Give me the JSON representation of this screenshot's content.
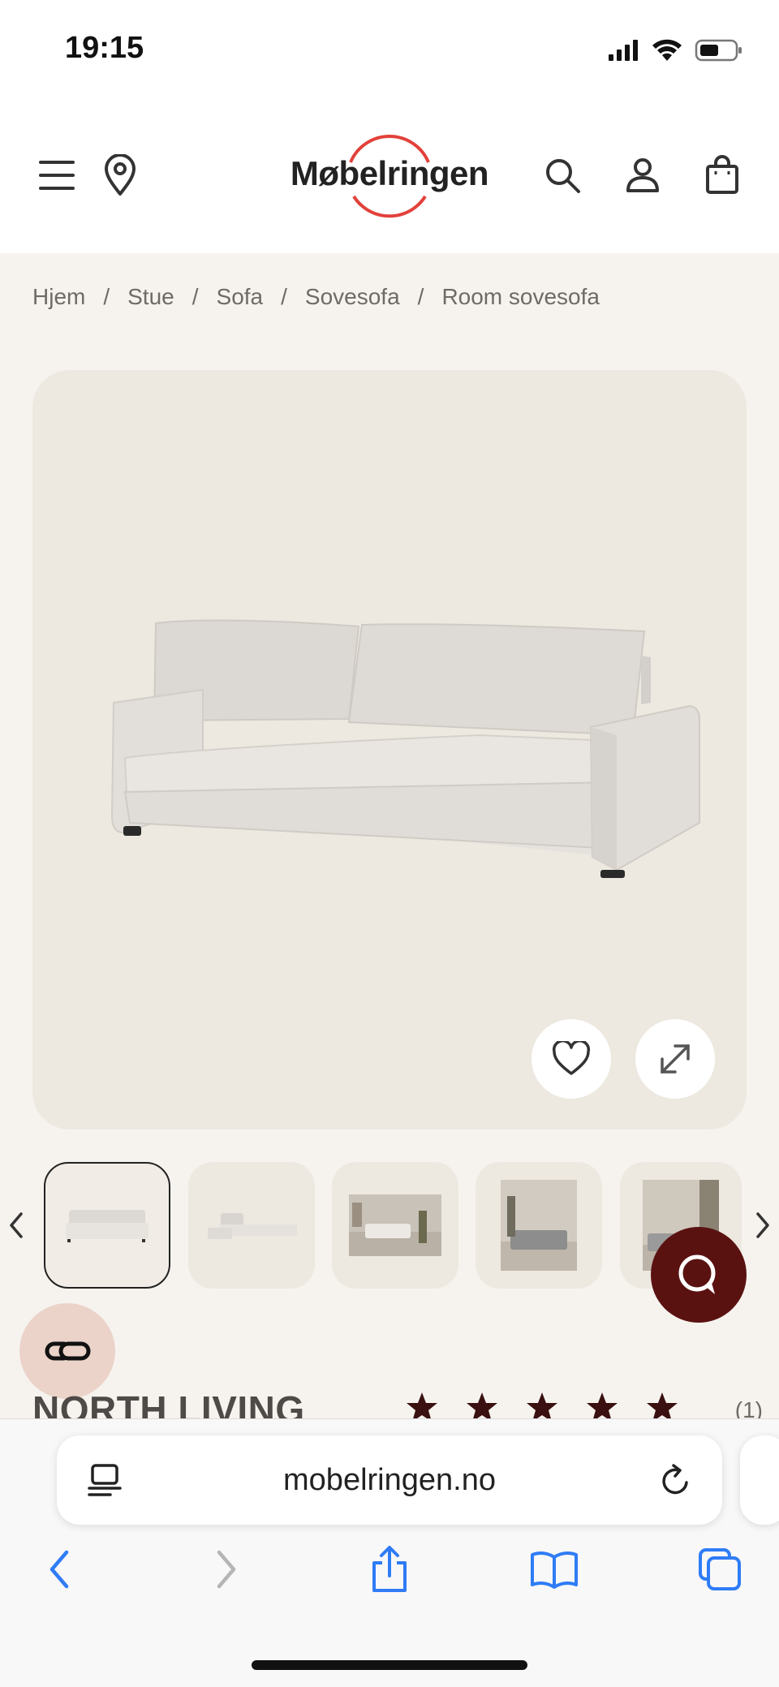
{
  "status_bar": {
    "time": "19:15"
  },
  "header": {
    "logo_text": "Møbelringen",
    "brand_color": "#e2413a"
  },
  "breadcrumb": [
    "Hjem",
    "Stue",
    "Sofa",
    "Sovesofa",
    "Room sovesofa"
  ],
  "product": {
    "brand": "NORTH LIVING",
    "rating_stars": 5,
    "review_count": "(1)"
  },
  "thumbnails": [
    "sofa-front",
    "sofa-bed-open",
    "living-room-1",
    "living-room-2",
    "living-room-3"
  ],
  "browser": {
    "url": "mobelringen.no"
  },
  "colors": {
    "chat_button": "#5a1211",
    "co_button": "#ebd3c9",
    "link_blue": "#2f7cf6"
  }
}
